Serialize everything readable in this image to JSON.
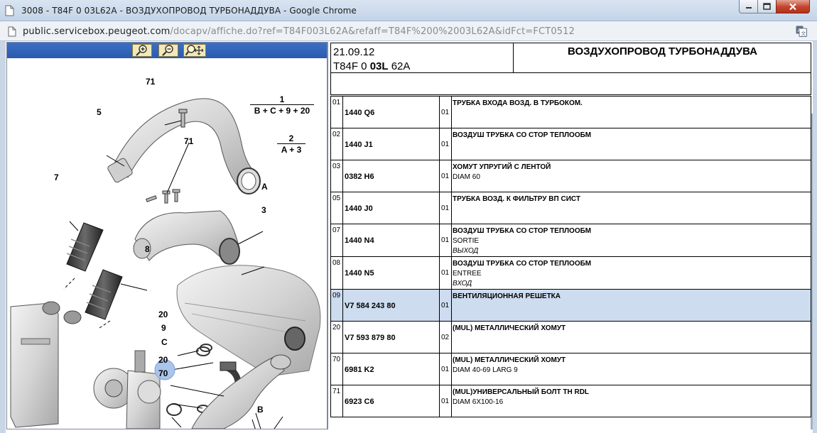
{
  "window": {
    "title": "3008 - T84F 0 03L62A - ВОЗДУХОПРОВОД ТУРБОНАДДУВА - Google Chrome"
  },
  "address": {
    "host": "public.servicebox.peugeot.com",
    "path": "/docapv/affiche.do?ref=T84F003L62A&refaff=T84F%200%2003L62A&idFct=FCT0512"
  },
  "zoom_toolbar": {
    "icons": [
      "zoom-in-icon",
      "zoom-out-icon",
      "zoom-pan-icon"
    ]
  },
  "diagram": {
    "callouts": {
      "c71_top": "71",
      "c5": "5",
      "c71_mid": "71",
      "c7": "7",
      "cA": "A",
      "c3": "3",
      "c8": "8",
      "c20_a": "20",
      "c9": "9",
      "cC": "C",
      "c20_b": "20",
      "c70": "70",
      "cB": "B"
    },
    "formula1": {
      "top": "1",
      "bottom": "B + C + 9 + 20"
    },
    "formula2": {
      "top": "2",
      "bottom": "A + 3"
    },
    "highlight_color": "#aac4ea"
  },
  "header": {
    "date": "21.09.12",
    "ref_prefix": "T84F 0 ",
    "ref_bold": "03L",
    "ref_suffix": " 62A",
    "title": "ВОЗДУХОПРОВОД ТУРБОНАДДУВА"
  },
  "parts": [
    {
      "idx": "01",
      "ref": "1440 Q6",
      "qty": "01",
      "name": "ТРУБКА ВХОДА ВОЗД. В ТУРБОКОМ.",
      "sub": "",
      "ital": "",
      "selected": false
    },
    {
      "idx": "02",
      "ref": "1440 J1",
      "qty": "01",
      "name": "ВОЗДУШ ТРУБКА СО СТОР ТЕПЛООБМ",
      "sub": "",
      "ital": "",
      "selected": false
    },
    {
      "idx": "03",
      "ref": "0382 H6",
      "qty": "01",
      "name": "ХОМУТ УПРУГИЙ С ЛЕНТОЙ",
      "sub": "DIAM 60",
      "ital": "",
      "selected": false
    },
    {
      "idx": "05",
      "ref": "1440 J0",
      "qty": "01",
      "name": "ТРУБКА ВОЗД. К ФИЛЬТРУ ВП СИСТ",
      "sub": "",
      "ital": "",
      "selected": false
    },
    {
      "idx": "07",
      "ref": "1440 N4",
      "qty": "01",
      "name": "ВОЗДУШ ТРУБКА СО СТОР ТЕПЛООБМ",
      "sub": "SORTIE",
      "ital": "ВЫХОД",
      "selected": false
    },
    {
      "idx": "08",
      "ref": "1440 N5",
      "qty": "01",
      "name": "ВОЗДУШ ТРУБКА СО СТОР ТЕПЛООБМ",
      "sub": "ENTREE",
      "ital": "ВХОД",
      "selected": false
    },
    {
      "idx": "09",
      "ref": "V7 584 243 80",
      "qty": "01",
      "name": "ВЕНТИЛЯЦИОННАЯ РЕШЕТКА",
      "sub": "",
      "ital": "",
      "selected": true
    },
    {
      "idx": "20",
      "ref": "V7 593 879 80",
      "qty": "02",
      "name": "(MUL) МЕТАЛЛИЧЕСКИЙ ХОМУТ",
      "sub": "",
      "ital": "",
      "selected": false
    },
    {
      "idx": "70",
      "ref": "6981 K2",
      "qty": "01",
      "name": "(MUL) МЕТАЛЛИЧЕСКИЙ ХОМУТ",
      "sub": "DIAM 40-69 LARG 9",
      "ital": "",
      "selected": false
    },
    {
      "idx": "71",
      "ref": "6923 C6",
      "qty": "01",
      "name": "(MUL)УНИВЕРСАЛЬНЫЙ БОЛТ TH RDL",
      "sub": "DIAM 6X100-16",
      "ital": "",
      "selected": false
    }
  ]
}
